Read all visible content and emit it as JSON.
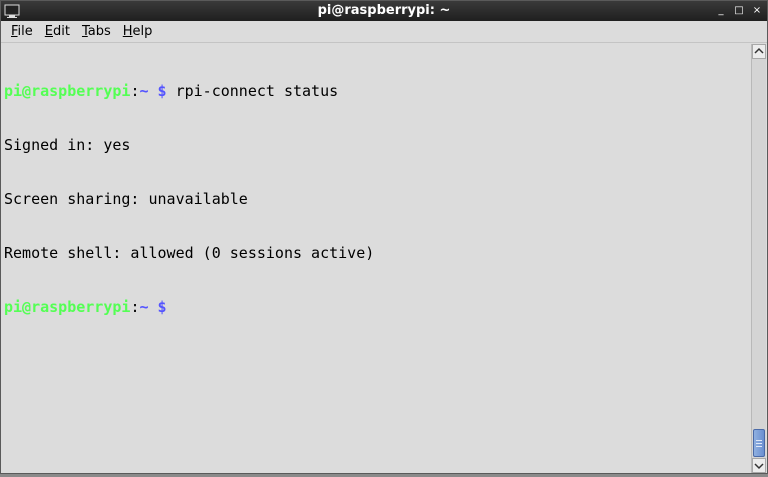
{
  "window": {
    "title": "pi@raspberrypi: ~",
    "controls": {
      "minimize": "_",
      "maximize": "□",
      "close": "×"
    }
  },
  "menu": {
    "file": {
      "mnemonic": "F",
      "rest": "ile"
    },
    "edit": {
      "mnemonic": "E",
      "rest": "dit"
    },
    "tabs": {
      "mnemonic": "T",
      "rest": "abs"
    },
    "help": {
      "mnemonic": "H",
      "rest": "elp"
    }
  },
  "terminal": {
    "prompt": {
      "user_host": "pi@raspberrypi",
      "sep": ":",
      "path": "~",
      "dollar": " $"
    },
    "command": " rpi-connect status",
    "output": [
      "Signed in: yes",
      "Screen sharing: unavailable",
      "Remote shell: allowed (0 sessions active)"
    ]
  },
  "colors": {
    "prompt_user": "#54ff54",
    "prompt_path": "#5454ff",
    "background": "#dcdcdc"
  },
  "icons": {
    "app": "terminal-icon",
    "scroll_up": "up-arrow-icon",
    "scroll_down": "down-arrow-icon"
  }
}
